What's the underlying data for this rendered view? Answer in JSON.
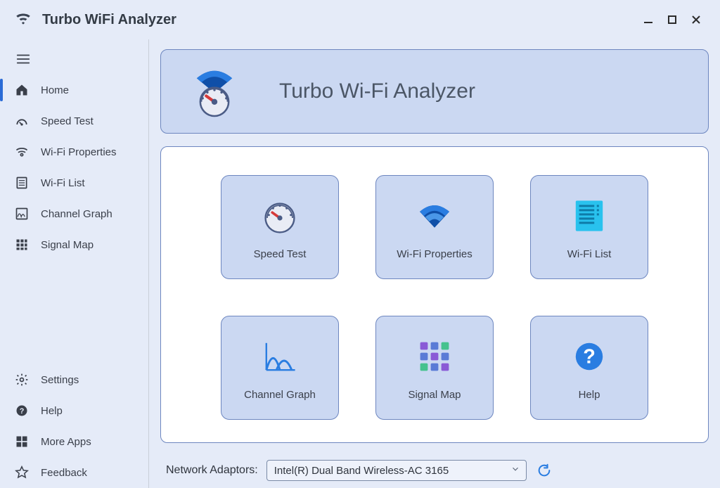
{
  "app": {
    "title": "Turbo WiFi Analyzer"
  },
  "sidebar": {
    "items": [
      {
        "label": "Home",
        "icon": "home"
      },
      {
        "label": "Speed Test",
        "icon": "gauge"
      },
      {
        "label": "Wi-Fi Properties",
        "icon": "wifi"
      },
      {
        "label": "Wi-Fi List",
        "icon": "list"
      },
      {
        "label": "Channel Graph",
        "icon": "graph"
      },
      {
        "label": "Signal Map",
        "icon": "grid"
      }
    ],
    "footer": [
      {
        "label": "Settings",
        "icon": "gear"
      },
      {
        "label": "Help",
        "icon": "help"
      },
      {
        "label": "More Apps",
        "icon": "windows"
      },
      {
        "label": "Feedback",
        "icon": "star"
      }
    ]
  },
  "hero": {
    "title": "Turbo Wi-Fi Analyzer"
  },
  "tiles": [
    {
      "label": "Speed Test"
    },
    {
      "label": "Wi-Fi Properties"
    },
    {
      "label": "Wi-Fi List"
    },
    {
      "label": "Channel Graph"
    },
    {
      "label": "Signal Map"
    },
    {
      "label": "Help"
    }
  ],
  "adaptor": {
    "label": "Network Adaptors:",
    "selected": "Intel(R) Dual Band Wireless-AC 3165"
  }
}
